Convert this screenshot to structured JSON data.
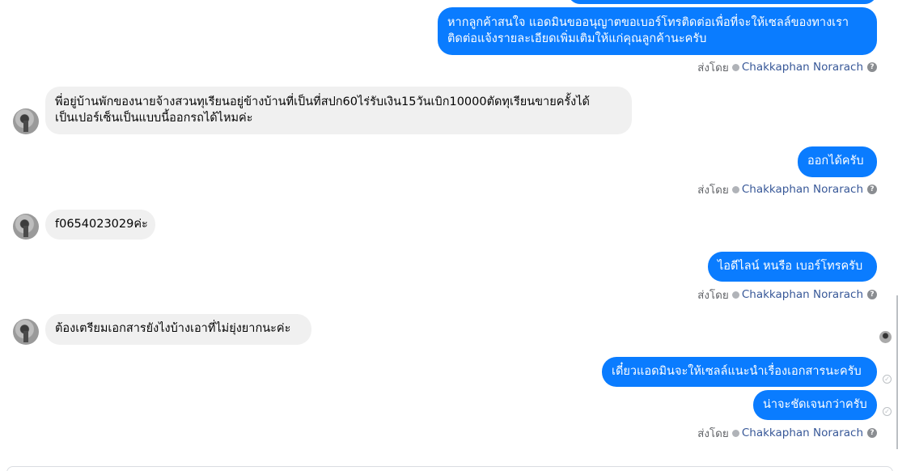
{
  "agent_name": "Chakkaphan Norarach",
  "sent_by_label": "ส่งโดย",
  "messages": [
    {
      "lines": [
        "หากลูกค้าสนใจ แอดมินขออนุญาตขอเบอร์โทรติดต่อเพื่อที่จะให้เซลล์ของทางเรา",
        "ติดต่อแจ้งรายละเอียดเพิ่มเติมให้แก่คุณลูกค้านะครับ"
      ]
    },
    {
      "lines": [
        "พี่อยู่บ้านพักของนายจ้างสวนทุเรียนอยู่ข้างบ้านที่เป็นที่สปก60ไร่รับเงิน15วันเบิก10000ตัดทุเรียนขายครั้งได้",
        "เป็นเปอร์เซ็นเป็นแบบนี้ออกรถได้ไหมค่ะ"
      ]
    },
    {
      "text": "ออกได้ครับ"
    },
    {
      "text": "f0654023029ค่ะ"
    },
    {
      "text": "ไอดีไลน์ หนรือ เบอร์โทรครับ"
    },
    {
      "text": "ต้องเตรียมเอกสารยังไงบ้างเอาที่ไม่ยุ่งยากนะค่ะ"
    },
    {
      "text": "เดี๋ยวแอดมินจะให้เซลล์แนะนำเรื่องเอกสารนะครับ"
    },
    {
      "text": "น่าจะชัดเจนกว่าครับ"
    }
  ]
}
